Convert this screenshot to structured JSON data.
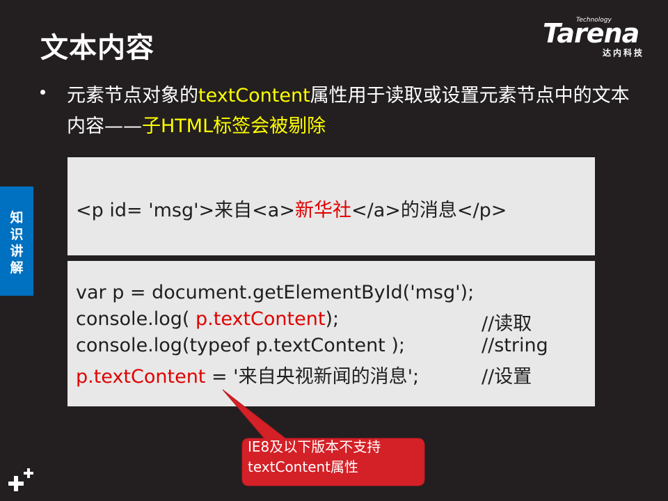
{
  "slide": {
    "title": "文本内容"
  },
  "logo": {
    "tech": "Technology",
    "main": "Tarena",
    "sub": "达内科技"
  },
  "bullet": {
    "part1": "元素节点对象的",
    "highlight1": "textContent",
    "part2": "属性用于读取或设置元素节点中的文本内容——",
    "highlight2": "子HTML标签会被剔除"
  },
  "side_tab": {
    "chars": [
      "知",
      "识",
      "讲",
      "解"
    ]
  },
  "html_example": {
    "before": "<p id= 'msg'>来自<a>",
    "highlight": "新华社",
    "after": "</a>的消息</p>"
  },
  "js_example": {
    "line1": "var p = document.getElementById('msg');",
    "line2_prefix": "console.log( ",
    "line2_highlight": "p.textContent",
    "line2_suffix": ");",
    "line2_comment": "//读取",
    "line3": "console.log(typeof p.textContent );",
    "line3_comment": "//string",
    "line4_highlight": "p.textContent",
    "line4_suffix": " = '来自央视新闻的消息';",
    "line4_comment": "//设置"
  },
  "callout": {
    "line1": "IE8及以下版本不支持",
    "line2": "textContent属性"
  },
  "colors": {
    "background": "#231f20",
    "highlight": "#ffff00",
    "side_tab": "#0070c0",
    "code_box": "#e8e8e8",
    "code_red": "#e00000",
    "callout": "#d42027"
  }
}
